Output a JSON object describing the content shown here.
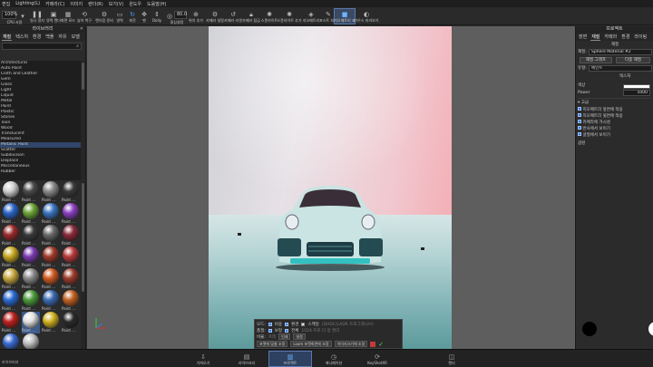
{
  "menubar": [
    "편집",
    "Lighting(L)",
    "카메라(C)",
    "이미지",
    "랜더(R)",
    "보기(V)",
    "윈도우",
    "도움말(H)"
  ],
  "toolbar": {
    "zoom": "100%",
    "cpu_label": "CPU 사용",
    "pause_label": "일시 정지",
    "area_label": "영역 렌더",
    "buttons": [
      "화면 모드",
      "뷰어 복구",
      "렌더링 준비",
      "영역",
      "회전",
      "팬",
      "Dolly",
      "중심설정",
      "위치 추가",
      "카메라 설정",
      "카메라 리셋",
      "카메라 잠금",
      "스폿라이트",
      "스폿라이트 추가",
      "지오메트리",
      "포스트 처리",
      "가우스 미리보기"
    ],
    "fov_value": "80.0",
    "active": "지오메트리 표"
  },
  "left_panel": {
    "title": "라이브러리",
    "tabs": [
      "재질",
      "텍스처",
      "환경",
      "백플",
      "자유",
      "모델"
    ],
    "active_tab": "재질",
    "categories": [
      "Architectural",
      "Auto Paint",
      "Cloth and Leather",
      "Gem",
      "Glass",
      "Light",
      "Liquid",
      "Metal",
      "Paint",
      "Plastic",
      "Stones",
      "Toon",
      "Wood",
      "Translucent",
      "Measured",
      "Metallic Paint",
      "Scatter",
      "Subdivision",
      "Displace",
      "Miscellaneous",
      "Rubber"
    ],
    "selected_category": "Metallic Paint",
    "materials": [
      {
        "label": "Paint ...",
        "color": "#d0d0d0"
      },
      {
        "label": "Paint ...",
        "color": "#4a4a4a"
      },
      {
        "label": "Paint ...",
        "color": "#8a8a8a"
      },
      {
        "label": "Paint ...",
        "color": "#3a3a3a"
      },
      {
        "label": "Paint ...",
        "color": "#2a64c8"
      },
      {
        "label": "Paint ...",
        "color": "#6aa236"
      },
      {
        "label": "Paint ...",
        "color": "#3a74c0"
      },
      {
        "label": "Paint ...",
        "color": "#8a40c0"
      },
      {
        "label": "Paint ...",
        "color": "#9a2a2a"
      },
      {
        "label": "Paint ...",
        "color": "#3a3a3a"
      },
      {
        "label": "Paint ...",
        "color": "#6a6a6a"
      },
      {
        "label": "Paint ...",
        "color": "#8a2a3a"
      },
      {
        "label": "Paint ...",
        "color": "#c8a820"
      },
      {
        "label": "Paint ...",
        "color": "#7a3ab0"
      },
      {
        "label": "Paint ...",
        "color": "#a03a2a"
      },
      {
        "label": "Paint ...",
        "color": "#b83a3a"
      },
      {
        "label": "Paint ...",
        "color": "#c8a840"
      },
      {
        "label": "Paint ...",
        "color": "#8a8a8a"
      },
      {
        "label": "Paint ...",
        "color": "#d05a20"
      },
      {
        "label": "Paint ...",
        "color": "#9a3a2a"
      },
      {
        "label": "Paint ...",
        "color": "#2a6ad0"
      },
      {
        "label": "Paint ...",
        "color": "#4a9a3a"
      },
      {
        "label": "Paint ...",
        "color": "#3a6ab0"
      },
      {
        "label": "Paint ...",
        "color": "#c06020"
      },
      {
        "label": "Paint ...",
        "color": "#c02020"
      },
      {
        "label": "Paint ...",
        "color": "#e0e0e0"
      },
      {
        "label": "Paint ...",
        "color": "#d0b020"
      },
      {
        "label": "Paint ...",
        "color": "#2a2a2a"
      },
      {
        "label": "Wet C...",
        "color": "#3a6ad0"
      },
      {
        "label": "Wet ...",
        "color": "#c0c0c0"
      }
    ],
    "selected_material_index": 25
  },
  "render_settings": {
    "row1": {
      "label": "모드:",
      "opt1": "비용",
      "opt2": "환경",
      "opt3": "스케일"
    },
    "row1_right": "(DHDC/LADR 프로그레시브)",
    "row2": {
      "label": "품질:",
      "opt1": "보정",
      "opt2": "전체"
    },
    "row2_right": "1024 프로 다 방 렌더",
    "row3": {
      "label": "비율:",
      "value": "프레",
      "btn1": "인쇄",
      "btn2": "설정"
    },
    "row4": {
      "btn1": "포맷에 맞춤 조정",
      "btn2": "Loam 포맷화면에 조정",
      "btn3": "이미지크기에 조정"
    }
  },
  "right_panel": {
    "title": "프로젝트",
    "tabs": [
      "장면",
      "재질",
      "카메라",
      "환경",
      "라이팅"
    ],
    "subtitle": "재질",
    "material_label": "재질:",
    "material_name": "Sphere Material #2",
    "btn_edit": "재질 그래프",
    "btn_multi": "다중 재질",
    "type_label": "유형:",
    "type_value": "페인트",
    "texture_tab": "텍스처",
    "color_label": "색상",
    "power_label": "Power",
    "power_value": "5000",
    "section_label": "고급",
    "options": [
      "지오메트리 앞면에 적용",
      "지오메트리 뒷면에 적용",
      "카메라에 가시성",
      "반사에서 보이기",
      "굴절에서 보이기"
    ],
    "footer_label": "광원"
  },
  "bottombar": {
    "left_label": "라이브러리",
    "items": [
      "가져오기",
      "라이브러리",
      "프로젝트",
      "애니메이션",
      "KeyShotXR",
      "렌더"
    ],
    "active": "프로젝트"
  },
  "colors": {
    "accent": "#3d5a8a",
    "panel": "#2b2b2b",
    "viewport": "#5e5e5e"
  }
}
